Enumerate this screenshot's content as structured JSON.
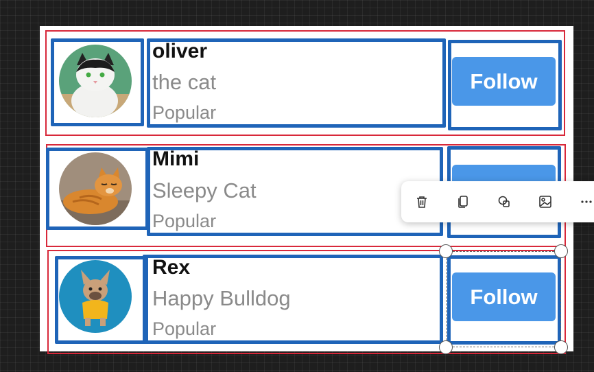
{
  "cards": [
    {
      "name": "oliver",
      "subtitle": "the cat",
      "tag": "Popular",
      "button": "Follow",
      "avatar": "black-white-cat-photo"
    },
    {
      "name": "Mimi",
      "subtitle": "Sleepy Cat",
      "tag": "Popular",
      "button": "Follow",
      "avatar": "orange-tabby-cat-photo"
    },
    {
      "name": "Rex",
      "subtitle": "Happy Bulldog",
      "tag": "Popular",
      "button": "Follow",
      "avatar": "french-bulldog-photo"
    }
  ],
  "toolbar": {
    "icons": [
      "trash-icon",
      "copy-icon",
      "shapes-icon",
      "image-icon",
      "more-icon"
    ]
  },
  "colors": {
    "canvas": "#1e1e1e",
    "outline_red": "#d8283a",
    "outline_blue": "#1f64b8",
    "button": "#4a97e8",
    "muted_text": "#8a8a8a"
  }
}
